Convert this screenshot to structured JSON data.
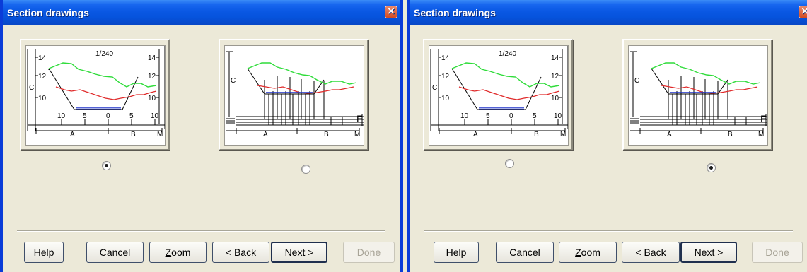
{
  "dialogs": [
    {
      "title": "Section drawings",
      "selected": 0,
      "options": [
        {
          "scale": "1/240",
          "ticks_top": [
            "14",
            "14"
          ],
          "ticks_mid": [
            "12",
            "12"
          ],
          "ticks_low": [
            "10",
            "10"
          ],
          "offsets": [
            "10",
            "5",
            "0",
            "5",
            "10"
          ],
          "label_a": "A",
          "label_b": "B",
          "label_c": "C",
          "label_m": "M"
        },
        {
          "label_a": "A",
          "label_b": "B",
          "label_c": "C",
          "label_e": "E",
          "label_m": "M"
        }
      ],
      "buttons": {
        "help": "Help",
        "cancel": "Cancel",
        "zoom": "Zoom",
        "back": "< Back",
        "next": "Next >",
        "done": "Done"
      }
    },
    {
      "title": "Section drawings",
      "selected": 1,
      "options": [
        {
          "scale": "1/240",
          "ticks_top": [
            "14",
            "14"
          ],
          "ticks_mid": [
            "12",
            "12"
          ],
          "ticks_low": [
            "10",
            "10"
          ],
          "offsets": [
            "10",
            "5",
            "0",
            "5",
            "10"
          ],
          "label_a": "A",
          "label_b": "B",
          "label_c": "C",
          "label_m": "M"
        },
        {
          "label_a": "A",
          "label_b": "B",
          "label_c": "C",
          "label_e": "E",
          "label_m": "M"
        }
      ],
      "buttons": {
        "help": "Help",
        "cancel": "Cancel",
        "zoom": "Zoom",
        "back": "< Back",
        "next": "Next >",
        "done": "Done"
      }
    }
  ],
  "colors": {
    "green_profile": "#2fdc3a",
    "red_profile": "#e02a2a",
    "blue_profile": "#1a2fc8"
  }
}
